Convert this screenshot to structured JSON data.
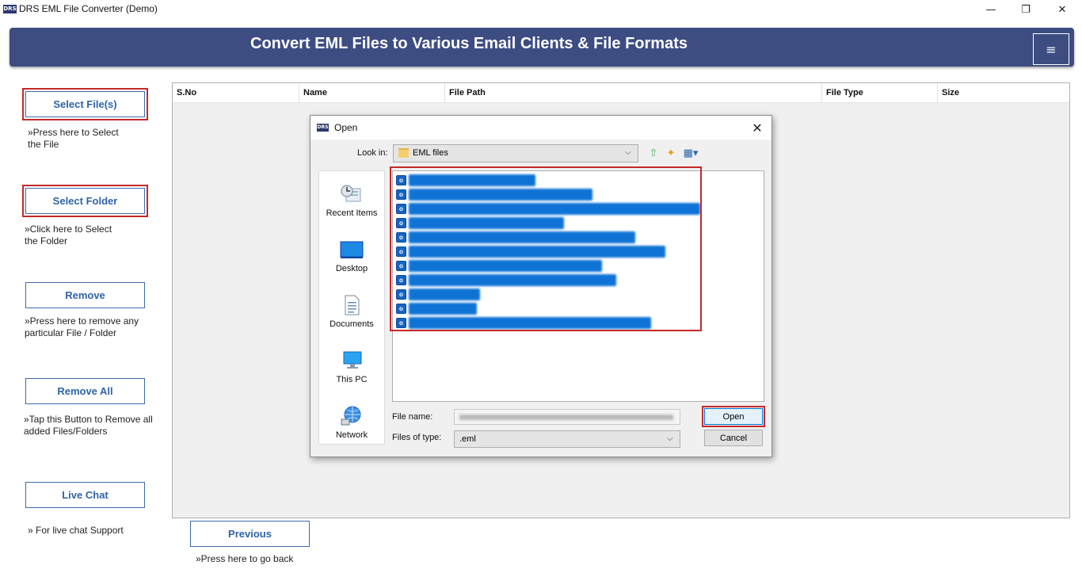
{
  "window": {
    "logo": "DRS",
    "title": "DRS EML File Converter (Demo)",
    "minimize": "—",
    "maximize": "❐",
    "close": "✕"
  },
  "header": {
    "title": "Convert EML Files to Various Email Clients & File Formats",
    "menu_icon": "≡"
  },
  "sidebar": {
    "select_files": {
      "label": "Select File(s)",
      "hint_line1": "»Press here to Select",
      "hint_line2": "the File"
    },
    "select_folder": {
      "label": "Select Folder",
      "hint_line1": "»Click here to Select",
      "hint_line2": "the Folder"
    },
    "remove": {
      "label": "Remove",
      "hint_line1": "»Press here to remove any",
      "hint_line2": "particular File / Folder"
    },
    "remove_all": {
      "label": "Remove All",
      "hint_line1": "»Tap this Button to Remove all",
      "hint_line2": "added Files/Folders"
    },
    "live_chat": {
      "label": "Live Chat",
      "hint_line1": "» For live chat Support"
    }
  },
  "table": {
    "columns": [
      "S.No",
      "Name",
      "File Path",
      "File Type",
      "Size"
    ]
  },
  "footer": {
    "previous_label": "Previous",
    "previous_hint": "»Press here to go back"
  },
  "dialog": {
    "logo": "DRS",
    "title": "Open",
    "close": "✕",
    "look_in_label": "Look in:",
    "look_in_value": "EML files",
    "dropdown_arrow": "⌵",
    "tools": {
      "up_folder": "⇧",
      "new_folder": "✦",
      "view_menu": "▦▾"
    },
    "places": [
      "Recent Items",
      "Desktop",
      "Documents",
      "This PC",
      "Network"
    ],
    "file_icon_letter": "o",
    "file_name_label": "File name:",
    "files_of_type_label": "Files of type:",
    "files_of_type_value": ".eml",
    "open_label": "Open",
    "cancel_label": "Cancel"
  },
  "colors": {
    "banner": "#3d4d82",
    "button_text": "#2f64a8",
    "highlight": "#c62828",
    "selection": "#0f73d6"
  }
}
